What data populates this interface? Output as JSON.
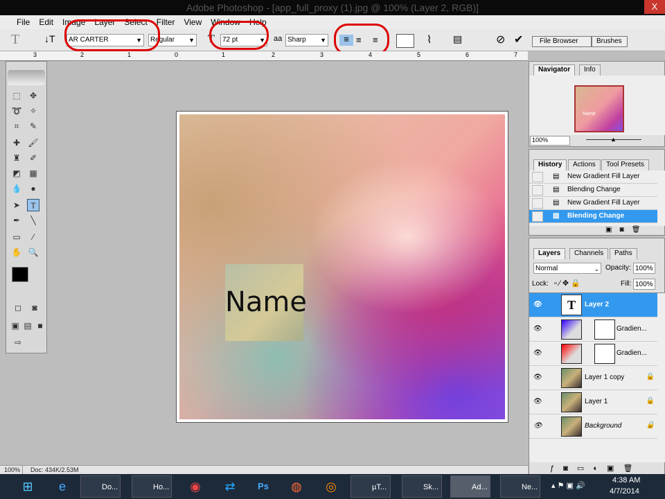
{
  "window": {
    "title": "Adobe Photoshop - [app_full_proxy (1).jpg @ 100% (Layer 2, RGB)]",
    "close": "X"
  },
  "menu": [
    "File",
    "Edit",
    "Image",
    "Layer",
    "Select",
    "Filter",
    "View",
    "Window",
    "Help"
  ],
  "options": {
    "font_family": "AR CARTER",
    "font_style": "Regular",
    "font_size": "72 pt",
    "antialias": "Sharp",
    "antialias_icon": "aa",
    "tabs": [
      "File Browser",
      "Brushes"
    ]
  },
  "ruler": [
    "3",
    "2",
    "1",
    "0",
    "1",
    "2",
    "3",
    "4",
    "5",
    "6",
    "7"
  ],
  "canvas": {
    "text": "Name"
  },
  "navigator": {
    "tabs": [
      "Navigator",
      "Info"
    ],
    "zoom": "100%",
    "thumb_text": "Name"
  },
  "history": {
    "tabs": [
      "History",
      "Actions",
      "Tool Presets"
    ],
    "items": [
      "New Gradient Fill Layer",
      "Blending Change",
      "New Gradient Fill Layer",
      "Blending Change"
    ]
  },
  "layers": {
    "tabs": [
      "Layers",
      "Channels",
      "Paths"
    ],
    "blend_mode": "Normal",
    "opacity_label": "Opacity:",
    "opacity": "100%",
    "lock_label": "Lock:",
    "fill_label": "Fill:",
    "fill": "100%",
    "items": [
      "Layer 2",
      "Gradien...",
      "Gradien...",
      "Layer 1 copy",
      "Layer 1",
      "Background"
    ]
  },
  "status": {
    "zoom": "100%",
    "doc": "Doc: 434K/2.53M"
  },
  "taskbar": {
    "items": [
      "Do...",
      "Ho...",
      "µT...",
      "Sk...",
      "Ad...",
      "Ne..."
    ],
    "time": "4:38 AM",
    "date": "4/7/2014"
  }
}
